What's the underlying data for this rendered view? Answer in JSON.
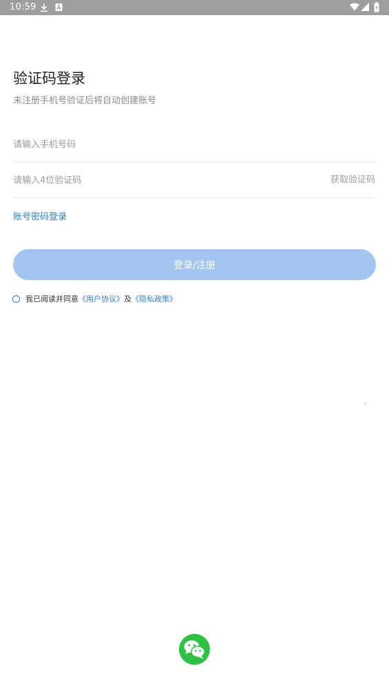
{
  "status_bar": {
    "time": "10:59",
    "left_icons": [
      "download-icon",
      "notification-a-icon"
    ],
    "right_icons": [
      "wifi-icon",
      "signal-icon",
      "battery-icon"
    ]
  },
  "header": {
    "title": "验证码登录",
    "subtitle": "未注册手机号验证后将自动创建账号"
  },
  "form": {
    "phone": {
      "value": "",
      "placeholder": "请输入手机号码"
    },
    "code": {
      "value": "",
      "placeholder": "请输入4位验证码",
      "get_code_label": "获取验证码"
    },
    "account_login_label": "账号密码登录",
    "submit_label": "登录/注册"
  },
  "agreement": {
    "checked": false,
    "prefix": "我已阅读并同意",
    "user_agreement": "《用户协议》",
    "conjunction": "及",
    "privacy_policy": "《隐私政策》"
  },
  "social_login": {
    "icon": "wechat-icon"
  },
  "colors": {
    "status_bar": "#9e9e9e",
    "accent": "#2f7fd6",
    "button_disabled": "#a3c4ef",
    "wechat": "#2fc146"
  }
}
